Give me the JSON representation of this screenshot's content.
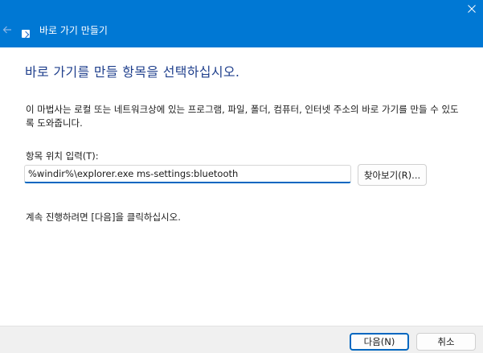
{
  "window": {
    "title": "바로 가기 만들기",
    "accent_color": "#0078d4",
    "back_icon": "back-arrow-icon",
    "close_icon": "close-icon",
    "app_icon": "shortcut-icon"
  },
  "main": {
    "heading": "바로 가기를 만들 항목을 선택하십시오.",
    "description": "이 마법사는 로컬 또는 네트워크상에 있는 프로그램, 파일, 폴더, 컴퓨터, 인터넷 주소의 바로 가기를 만들 수 있도록 도와줍니다.",
    "location_label": "항목 위치 입력(T):",
    "location_value": "%windir%\\explorer.exe ms-settings:bluetooth",
    "browse_label": "찾아보기(R)...",
    "continue_text": "계속 진행하려면 [다음]을 클릭하십시오."
  },
  "footer": {
    "next_label": "다음(N)",
    "cancel_label": "취소"
  }
}
